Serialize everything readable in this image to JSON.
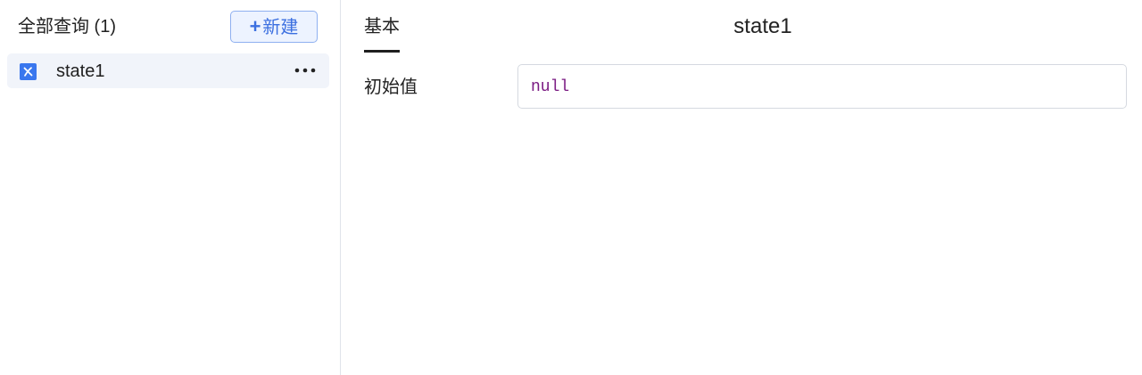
{
  "sidebar": {
    "title": "全部查询 (1)",
    "new_button": {
      "icon": "plus-icon",
      "label": "新建"
    },
    "items": [
      {
        "icon": "variable-icon",
        "label": "state1",
        "more_icon": "more-horizontal-icon"
      }
    ]
  },
  "detail": {
    "tabs": [
      {
        "label": "基本",
        "active": true
      }
    ],
    "title": "state1",
    "fields": [
      {
        "label": "初始值",
        "value": "null"
      }
    ]
  },
  "colors": {
    "accent": "#3b6fe0",
    "accent_bg": "#edf3ff",
    "selected_item_bg": "#f1f4fa",
    "value_text": "#7a1a82",
    "icon_bg": "#3a77ee"
  }
}
